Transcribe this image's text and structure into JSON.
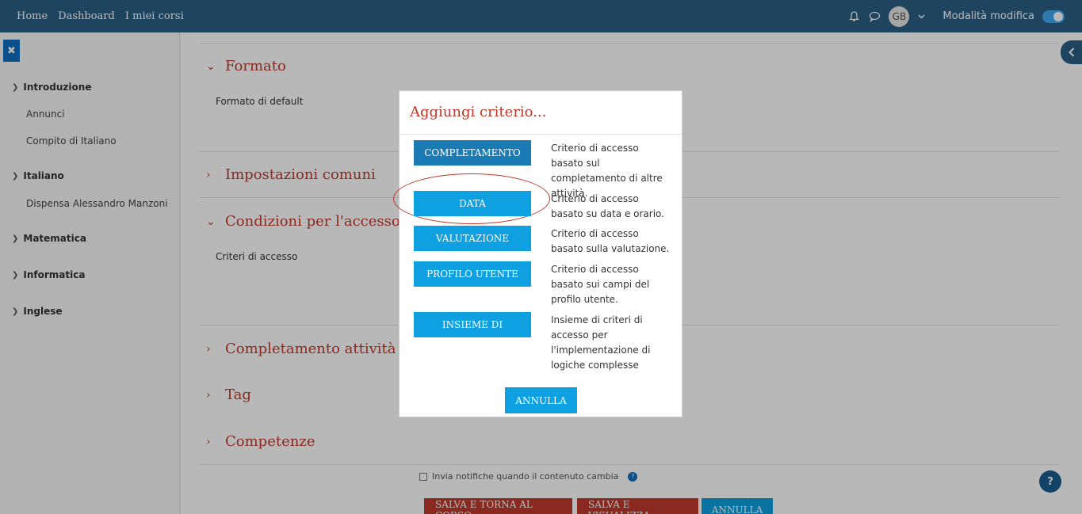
{
  "navbar": {
    "links": [
      "Home",
      "Dashboard",
      "I miei corsi"
    ],
    "avatar_initials": "GB",
    "edit_mode_label": "Modalità modifica"
  },
  "sidebar": {
    "close_symbol": "✖",
    "sections": [
      {
        "title": "Introduzione",
        "items": [
          "Annunci",
          "Compito di Italiano"
        ]
      },
      {
        "title": "Italiano",
        "items": [
          "Dispensa Alessandro Manzoni"
        ]
      },
      {
        "title": "Matematica",
        "items": []
      },
      {
        "title": "Informatica",
        "items": []
      },
      {
        "title": "Inglese",
        "items": []
      }
    ]
  },
  "main": {
    "sections": {
      "formato": "Formato",
      "impostazioni": "Impostazioni comuni",
      "condizioni": "Condizioni per l'accesso",
      "completamento": "Completamento attività",
      "tag": "Tag",
      "competenze": "Competenze"
    },
    "labels": {
      "formato_default": "Formato di default",
      "criteri_accesso": "Criteri di accesso"
    },
    "notify_label": "Invia notifiche quando il contenuto cambia",
    "buttons": {
      "save_return": "SALVA E TORNA AL CORSO",
      "save_view": "SALVA E VISUALIZZA",
      "cancel": "ANNULLA"
    },
    "help_symbol": "?"
  },
  "modal": {
    "title": "Aggiungi criterio...",
    "criteria": [
      {
        "label": "COMPLETAMENTO",
        "desc": "Criterio di accesso basato sul completamento di altre attività."
      },
      {
        "label": "DATA",
        "desc": "Criterio di accesso basato su data e orario."
      },
      {
        "label": "VALUTAZIONE",
        "desc": "Criterio di accesso basato sulla valutazione."
      },
      {
        "label": "PROFILO UTENTE",
        "desc": "Criterio di accesso basato sui campi del profilo utente."
      },
      {
        "label": "INSIEME DI",
        "desc": "Insieme di criteri di accesso per l'implementazione di logiche complesse"
      }
    ],
    "cancel_label": "ANNULLA"
  },
  "colors": {
    "navbar": "#2a5f85",
    "accent": "#0fa0e1",
    "heading": "#c0392b",
    "save_buttons": "#c0392b"
  }
}
